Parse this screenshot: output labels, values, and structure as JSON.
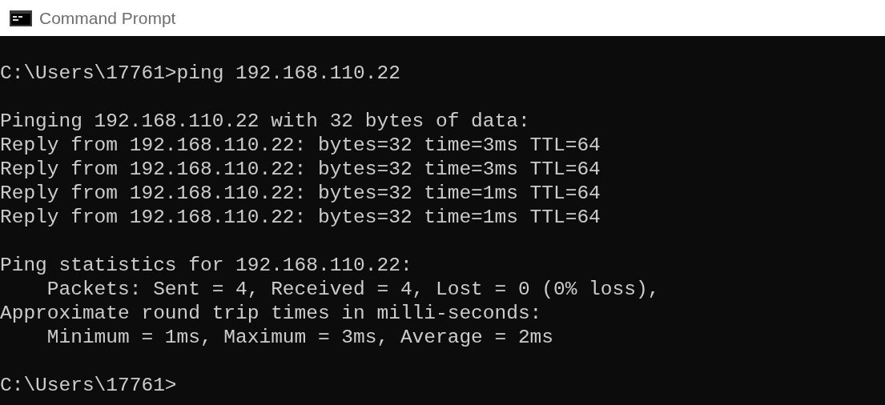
{
  "window": {
    "title": "Command Prompt"
  },
  "console": {
    "blocks": [
      {
        "lines": [
          "C:\\Users\\17761>ping 192.168.110.22"
        ]
      },
      {
        "lines": [
          "Pinging 192.168.110.22 with 32 bytes of data:",
          "Reply from 192.168.110.22: bytes=32 time=3ms TTL=64",
          "Reply from 192.168.110.22: bytes=32 time=3ms TTL=64",
          "Reply from 192.168.110.22: bytes=32 time=1ms TTL=64",
          "Reply from 192.168.110.22: bytes=32 time=1ms TTL=64"
        ]
      },
      {
        "lines": [
          "Ping statistics for 192.168.110.22:",
          "    Packets: Sent = 4, Received = 4, Lost = 0 (0% loss),",
          "Approximate round trip times in milli-seconds:",
          "    Minimum = 1ms, Maximum = 3ms, Average = 2ms"
        ]
      },
      {
        "lines": [
          "C:\\Users\\17761>"
        ]
      }
    ]
  }
}
